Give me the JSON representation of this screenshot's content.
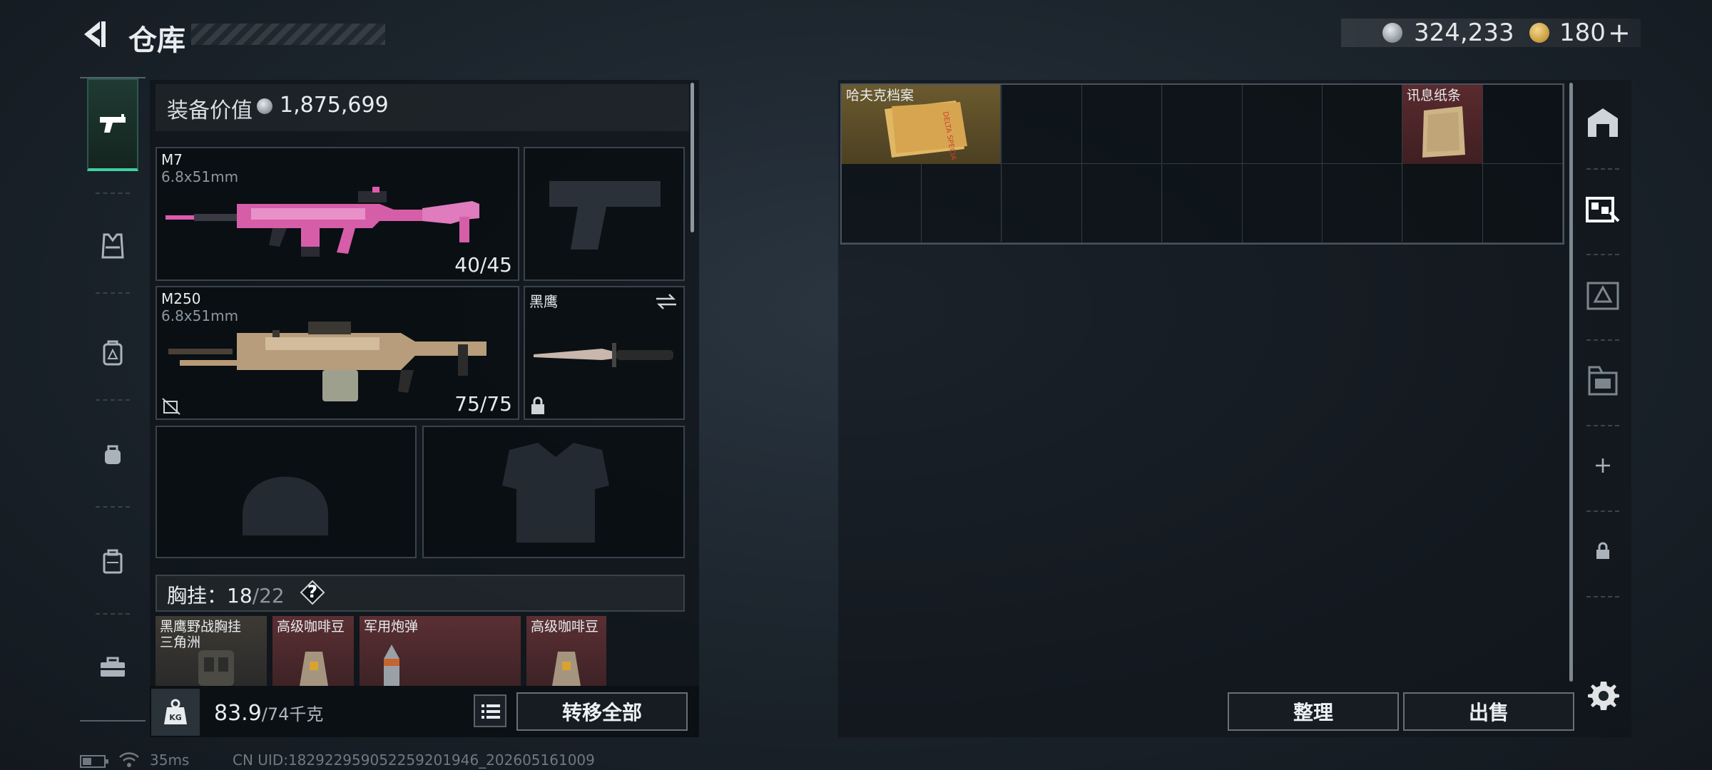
{
  "header": {
    "title": "仓库",
    "currency_silver": "324,233",
    "currency_gold": "180",
    "add_symbol": "+"
  },
  "equipment": {
    "value_label": "装备价值",
    "value": "1,875,699"
  },
  "weapons": [
    {
      "name": "M7",
      "caliber": "6.8x51mm",
      "ammo": "40/45",
      "colors": "pink camo"
    },
    {
      "name": "M250",
      "caliber": "6.8x51mm",
      "ammo": "75/75",
      "colors": "tan"
    }
  ],
  "melee": {
    "name": "黑鹰"
  },
  "chest_rig": {
    "label": "胸挂：",
    "used": "18",
    "capacity": "/22",
    "help": "?"
  },
  "rig_items": [
    {
      "name": "黑鹰野战胸挂\n三角洲"
    },
    {
      "name": "高级咖啡豆"
    },
    {
      "name": "军用炮弹"
    },
    {
      "name": "高级咖啡豆"
    }
  ],
  "weight": {
    "current": "83.9",
    "max": "/74千克"
  },
  "buttons": {
    "transfer_all": "转移全部",
    "organize": "整理",
    "sell": "出售"
  },
  "stash_items": [
    {
      "name": "哈夫克档案"
    },
    {
      "name": "讯息纸条"
    }
  ],
  "status": {
    "ping": "35ms",
    "uid": "CN UID:18292295905225920194​6_202605161009"
  },
  "colors": {
    "accent_green": "#3fd1a0",
    "rarity_gold": "#6b5a2e",
    "rarity_red": "#5a2a2e"
  }
}
